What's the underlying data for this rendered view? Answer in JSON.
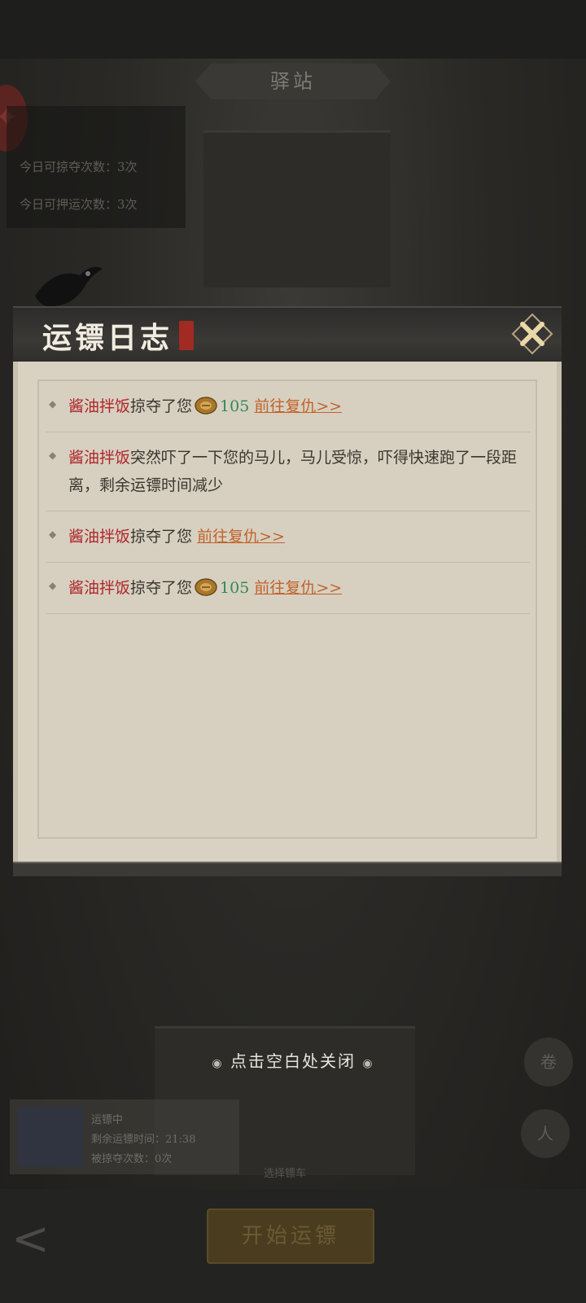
{
  "background": {
    "station_title": "驿站",
    "info_rows": [
      "今日可掠夺次数：3次",
      "今日可押运次数：3次"
    ],
    "start_button": "开始运镖",
    "bottom_caption": "选择镖车",
    "card_lines": [
      "运镖中",
      "剩余运镖时间：21:38",
      "被掠夺次数：0次"
    ]
  },
  "dialog": {
    "title": "运镖日志",
    "close_icon": "close-x-icon",
    "entries": [
      {
        "name": "酱油拌饭",
        "text": "掠夺了您",
        "has_coin": true,
        "amount": "105",
        "link": "前往复仇>>"
      },
      {
        "name": "酱油拌饭",
        "text": "突然吓了一下您的马儿，马儿受惊，吓得快速跑了一段距离，剩余运镖时间减少",
        "has_coin": false,
        "amount": "",
        "link": ""
      },
      {
        "name": "酱油拌饭",
        "text": "掠夺了您",
        "has_coin": false,
        "amount": "",
        "link": "前往复仇>>"
      },
      {
        "name": "酱油拌饭",
        "text": "掠夺了您",
        "has_coin": true,
        "amount": "105",
        "link": "前往复仇>>"
      }
    ]
  },
  "close_hint": "点击空白处关闭",
  "colors": {
    "name_red": "#b0262b",
    "amount_green": "#2f8a56",
    "link_orange": "#c0632b"
  }
}
